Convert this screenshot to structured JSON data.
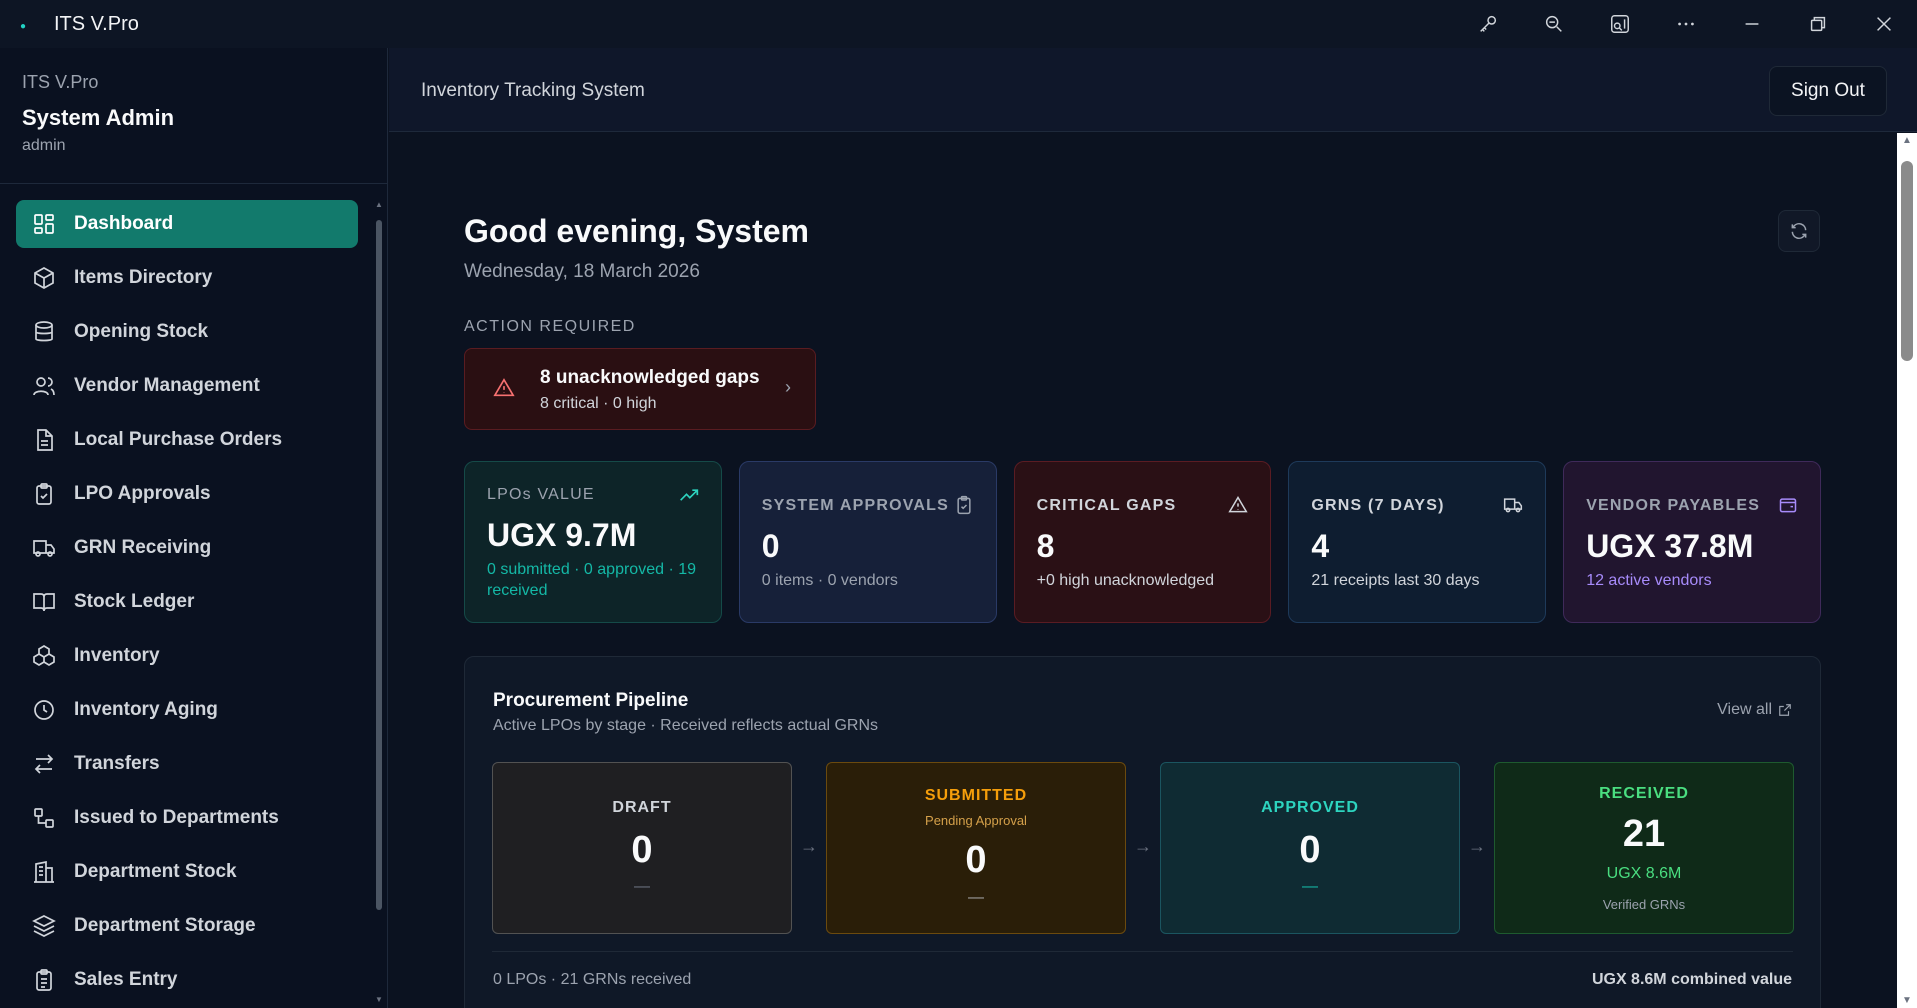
{
  "window": {
    "title": "ITS V.Pro",
    "actions": [
      "key-icon",
      "zoom-out-icon",
      "cast-icon",
      "more-icon",
      "minimize-icon",
      "restore-icon",
      "close-icon"
    ]
  },
  "sidebar": {
    "brand": "ITS V.Pro",
    "user_name": "System Admin",
    "user_role": "admin",
    "items": [
      {
        "label": "Dashboard",
        "icon": "dashboard-icon",
        "active": true
      },
      {
        "label": "Items Directory",
        "icon": "box-icon"
      },
      {
        "label": "Opening Stock",
        "icon": "database-icon"
      },
      {
        "label": "Vendor Management",
        "icon": "users-icon"
      },
      {
        "label": "Local Purchase Orders",
        "icon": "document-icon"
      },
      {
        "label": "LPO Approvals",
        "icon": "clipboard-check-icon"
      },
      {
        "label": "GRN Receiving",
        "icon": "truck-icon"
      },
      {
        "label": "Stock Ledger",
        "icon": "book-icon"
      },
      {
        "label": "Inventory",
        "icon": "boxes-icon"
      },
      {
        "label": "Inventory Aging",
        "icon": "clock-icon"
      },
      {
        "label": "Transfers",
        "icon": "transfer-icon"
      },
      {
        "label": "Issued to Departments",
        "icon": "route-icon"
      },
      {
        "label": "Department Stock",
        "icon": "building-icon"
      },
      {
        "label": "Department Storage",
        "icon": "layers-icon"
      },
      {
        "label": "Sales Entry",
        "icon": "clipboard-list-icon"
      }
    ]
  },
  "header": {
    "system_name": "Inventory Tracking System",
    "sign_out_label": "Sign Out"
  },
  "dashboard": {
    "greeting": "Good evening, System",
    "date": "Wednesday, 18 March 2026",
    "action_required_label": "ACTION REQUIRED",
    "alert": {
      "title": "8 unacknowledged gaps",
      "subtitle": "8 critical · 0 high"
    },
    "cards": [
      {
        "label": "LPOs VALUE",
        "value": "UGX 9.7M",
        "note": "0 submitted · 0 approved · 19 received",
        "icon": "trending-up-icon"
      },
      {
        "label": "SYSTEM APPROVALS",
        "value": "0",
        "note": "0 items · 0 vendors",
        "icon": "clipboard-check-icon"
      },
      {
        "label": "CRITICAL GAPS",
        "value": "8",
        "note": "+0 high unacknowledged",
        "icon": "warning-icon"
      },
      {
        "label": "GRNS (7 DAYS)",
        "value": "4",
        "note": "21 receipts last 30 days",
        "icon": "truck-icon"
      },
      {
        "label": "VENDOR PAYABLES",
        "value": "UGX 37.8M",
        "note": "12 active vendors",
        "icon": "wallet-icon"
      }
    ],
    "pipeline": {
      "title": "Procurement Pipeline",
      "subtitle": "Active LPOs by stage · Received reflects actual GRNs",
      "view_all": "View all",
      "stages": [
        {
          "name": "DRAFT",
          "value": "0",
          "foot": "—"
        },
        {
          "name": "SUBMITTED",
          "sub": "Pending Approval",
          "value": "0",
          "foot": "—"
        },
        {
          "name": "APPROVED",
          "value": "0",
          "foot": "—"
        },
        {
          "name": "RECEIVED",
          "value": "21",
          "foot": "UGX 8.6M",
          "foot2": "Verified GRNs"
        }
      ],
      "summary_left": "0 LPOs · 21 GRNs received",
      "summary_right": "UGX 8.6M combined value"
    }
  }
}
